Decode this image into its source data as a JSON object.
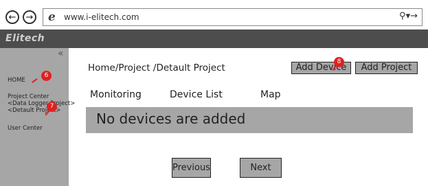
{
  "browser": {
    "url": "www.i-elitech.com",
    "back_glyph": "←",
    "forward_glyph": "→",
    "search_glyph": "⚲▾→"
  },
  "header": {
    "logo": "Elitech"
  },
  "sidebar": {
    "collapse_glyph": "«",
    "items": [
      {
        "label": "HOME"
      },
      {
        "label": "Project Center"
      },
      {
        "label": "<Data Logger Project>"
      },
      {
        "label": "<Detault Project>"
      },
      {
        "label": "User Center"
      }
    ]
  },
  "markers": [
    "6",
    "7",
    "8"
  ],
  "main": {
    "breadcrumb": "Home/Project /Detault Project",
    "add_device": "Add Device",
    "add_project": "Add Project",
    "tabs": [
      {
        "label": "Monitoring"
      },
      {
        "label": "Device List"
      },
      {
        "label": "Map"
      }
    ],
    "empty_message": "No devices are added",
    "pagination": {
      "previous": "Previous",
      "next": "Next"
    }
  },
  "colors": {
    "header": "#4d4d4d",
    "sidebar": "#a6a6a6",
    "marker": "#e02020"
  }
}
